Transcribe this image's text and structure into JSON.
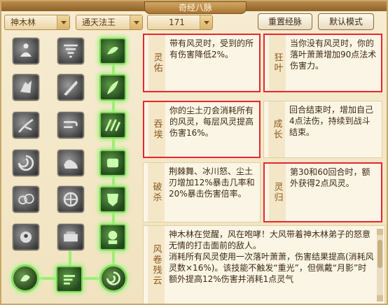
{
  "window": {
    "title": "奇经八脉"
  },
  "filters": {
    "school": "神木林",
    "style": "通天法王",
    "level": "171"
  },
  "buttons": {
    "reset": "重置经脉",
    "default": "默认模式"
  },
  "skills": {
    "lingyou": {
      "name": "灵佑",
      "desc": "带有风灵时，受到的所有伤害降低2%。"
    },
    "kuangye": {
      "name": "狂叶",
      "desc": "当你没有风灵时，你的落叶萧萧增加90点法术伤害力。"
    },
    "tuncai": {
      "name": "吞埃",
      "desc": "你的尘土刃会消耗所有的风灵，每层风灵提高伤害16%。"
    },
    "chengzhang": {
      "name": "成长",
      "desc": "回合结束时，增加自己4点法伤，持续到战斗结束。"
    },
    "posha": {
      "name": "破杀",
      "desc": "荆棘舞、冰川怒、尘土刃增加12%暴击几率和20%暴击伤害倍率。"
    },
    "linggui": {
      "name": "灵归",
      "desc": "第30和60回合时，额外获得2点风灵。"
    },
    "fengjuan": {
      "name": "风卷残云",
      "desc": "神木林在觉醒，风在咆哮！大风带着神木林弟子的怒意无情的打击面前的敌人。",
      "extra": "消耗所有风灵使用一次落叶萧萧，伤害结果提高(消耗风灵数×16%)。该技能不触发“重光”，但佩戴“月影”时额外提高12%伤害并消耗1点灵气"
    }
  },
  "colors": {
    "highlight": "#e8262d",
    "active": "#8fe06b",
    "label": "#8b5a1f"
  }
}
